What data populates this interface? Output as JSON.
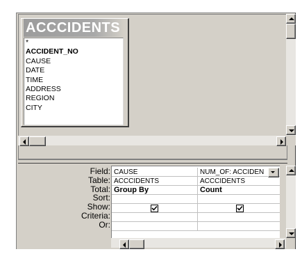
{
  "query": {
    "table": {
      "title": "ACCCIDENTS",
      "fields": [
        {
          "label": "*",
          "bold": false
        },
        {
          "label": "ACCIDENT_NO",
          "bold": true
        },
        {
          "label": "CAUSE",
          "bold": false
        },
        {
          "label": "DATE",
          "bold": false
        },
        {
          "label": "TIME",
          "bold": false
        },
        {
          "label": "ADDRESS",
          "bold": false
        },
        {
          "label": "REGION",
          "bold": false
        },
        {
          "label": "CITY",
          "bold": false
        }
      ]
    },
    "grid": {
      "row_labels": [
        "Field:",
        "Table:",
        "Total:",
        "Sort:",
        "Show:",
        "Criteria:",
        "Or:"
      ],
      "columns": [
        {
          "field": "CAUSE",
          "table": "ACCCIDENTS",
          "total": "Group By",
          "sort": "",
          "show": true,
          "criteria": "",
          "or": ""
        },
        {
          "field": "NUM_OF: ACCIDEN",
          "table": "ACCCIDENTS",
          "total": "Count",
          "sort": "",
          "show": true,
          "criteria": "",
          "or": "",
          "has_dropdown": true
        }
      ]
    }
  }
}
